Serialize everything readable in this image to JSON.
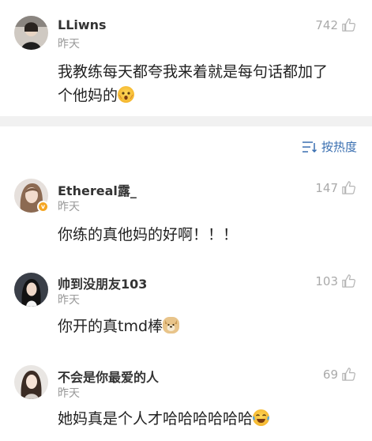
{
  "top_comment": {
    "username": "LLiwns",
    "time": "昨天",
    "likes": "742",
    "text_line1": "我教练每天都夸我来着就是每句话都加了",
    "text_line2": "个他妈的",
    "emoji": "shocked-face-emoji"
  },
  "sort": {
    "label": "按热度",
    "icon": "sort-list-icon"
  },
  "comments": [
    {
      "username": "Ethereal露_",
      "time": "昨天",
      "likes": "147",
      "text": "你练的真他妈的好啊！！！",
      "verified": true
    },
    {
      "username": "帅到没朋友103",
      "time": "昨天",
      "likes": "103",
      "text": "你开的真tmd棒",
      "emoji": "doge-emoji"
    },
    {
      "username": "不会是你最爱的人",
      "time": "昨天",
      "likes": "69",
      "text": "她妈真是个人才哈哈哈哈哈哈",
      "emoji": "laughing-tears-emoji"
    }
  ],
  "colors": {
    "link_blue": "#3a6fb0",
    "muted": "#999999",
    "separator": "#f1f1f1",
    "verified_badge": "#f5a623"
  }
}
